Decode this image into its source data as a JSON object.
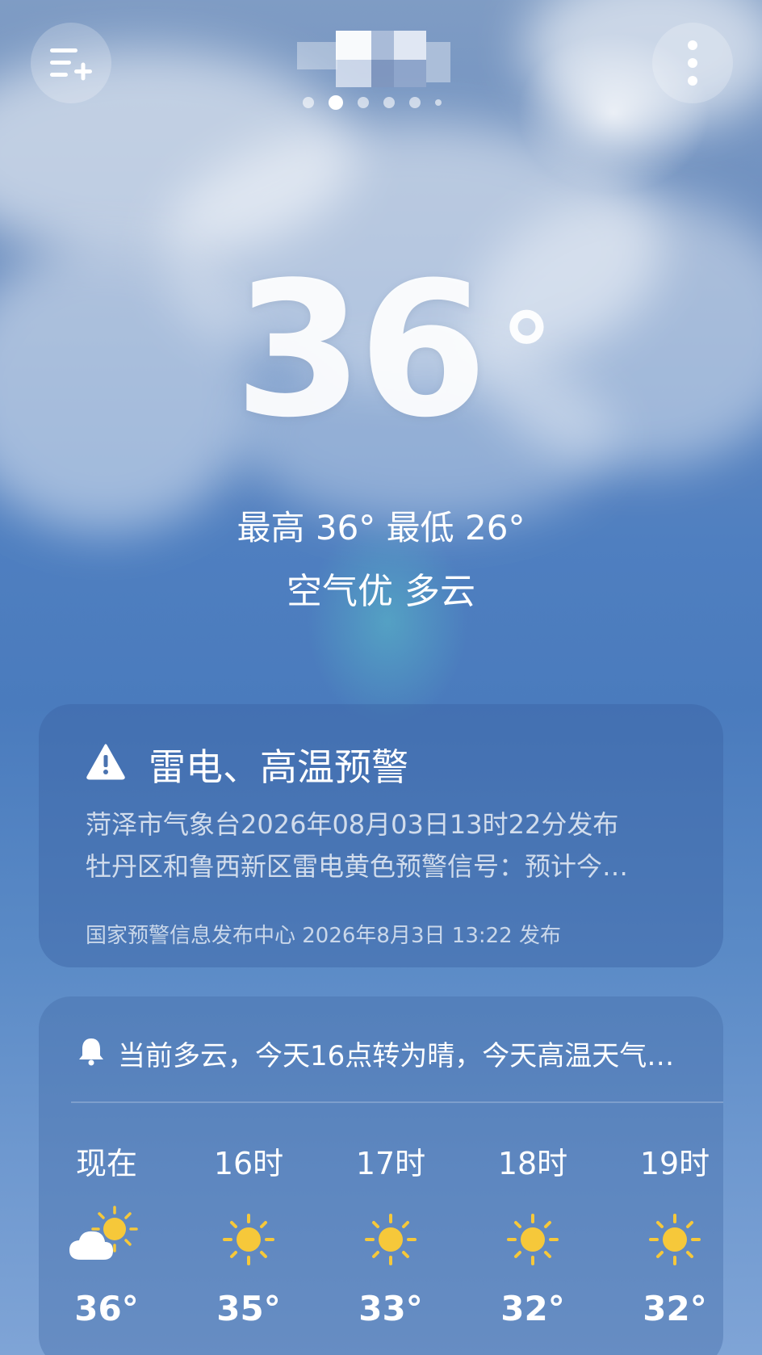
{
  "header": {
    "menu_icon": "list-add-icon",
    "more_icon": "more-vertical-icon",
    "page_dots": 6,
    "active_dot": 1
  },
  "current": {
    "temperature": "36",
    "degree": "°",
    "hi_lo": "最高 36° 最低 26°",
    "condition": "空气优  多云"
  },
  "alert": {
    "icon": "warning-triangle-icon",
    "title": "雷电、高温预警",
    "line1": "菏泽市气象台2026年08月03日13时22分发布",
    "line2": "牡丹区和鲁西新区雷电黄色预警信号：预计今…",
    "source": "国家预警信息发布中心 2026年8月3日 13:22 发布"
  },
  "forecast": {
    "summary_icon": "bell-icon",
    "summary": "当前多云，今天16点转为晴，今天高温天气…",
    "hours": [
      {
        "label": "现在",
        "icon": "partly-cloudy-icon",
        "temp": "36°"
      },
      {
        "label": "16时",
        "icon": "sun-icon",
        "temp": "35°"
      },
      {
        "label": "17时",
        "icon": "sun-icon",
        "temp": "33°"
      },
      {
        "label": "18时",
        "icon": "sun-icon",
        "temp": "32°"
      },
      {
        "label": "19时",
        "icon": "sun-icon",
        "temp": "32°"
      }
    ]
  },
  "colors": {
    "sun": "#f6c83a",
    "card": "#3c64a5"
  }
}
